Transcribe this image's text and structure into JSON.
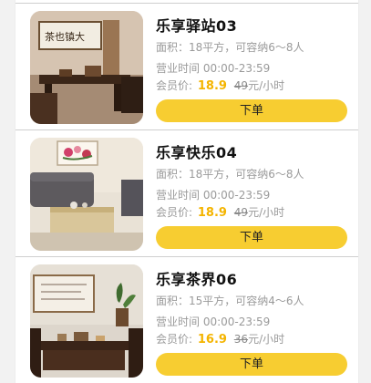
{
  "rooms": [
    {
      "name": "乐享驿站03",
      "area": "面积：18平方，可容纳6～8人",
      "hours": "营业时间 00:00-23:59",
      "price_label": "会员价:",
      "price": "18.9",
      "original_price": "49",
      "price_unit": "元/小时",
      "button_label": "下单",
      "image": "tea-room-calligraphy-photo"
    },
    {
      "name": "乐享快乐04",
      "area": "面积：18平方，可容纳6～8人",
      "hours": "营业时间 00:00-23:59",
      "price_label": "会员价:",
      "price": "18.9",
      "original_price": "49",
      "price_unit": "元/小时",
      "button_label": "下单",
      "image": "tea-room-sofa-photo"
    },
    {
      "name": "乐享茶界06",
      "area": "面积：15平方，可容纳4～6人",
      "hours": "营业时间 00:00-23:59",
      "price_label": "会员价:",
      "price": "16.9",
      "original_price": "36",
      "price_unit": "元/小时",
      "button_label": "下单",
      "image": "tea-room-table-photo"
    }
  ],
  "colors": {
    "accent_button": "#f7cd31",
    "price": "#f4b400",
    "meta_text": "#9a9a9a"
  }
}
